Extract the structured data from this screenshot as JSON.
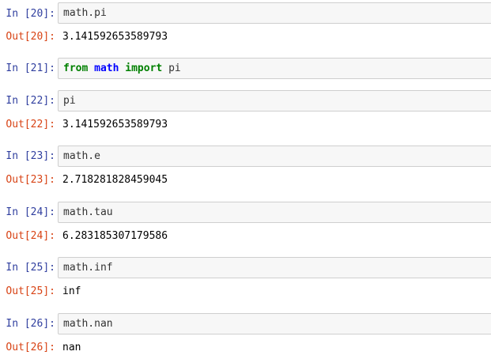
{
  "cells": [
    {
      "in_prompt": "In [20]:",
      "code": "math.pi",
      "out_prompt": "Out[20]:",
      "output": "3.141592653589793"
    },
    {
      "in_prompt": "In [21]:",
      "code_tokens": {
        "kw1": "from",
        "mod": "math",
        "kw2": "import",
        "name": "pi"
      }
    },
    {
      "in_prompt": "In [22]:",
      "code": "pi",
      "out_prompt": "Out[22]:",
      "output": "3.141592653589793"
    },
    {
      "in_prompt": "In [23]:",
      "code": "math.e",
      "out_prompt": "Out[23]:",
      "output": "2.718281828459045"
    },
    {
      "in_prompt": "In [24]:",
      "code": "math.tau",
      "out_prompt": "Out[24]:",
      "output": "6.283185307179586"
    },
    {
      "in_prompt": "In [25]:",
      "code": "math.inf",
      "out_prompt": "Out[25]:",
      "output": "inf"
    },
    {
      "in_prompt": "In [26]:",
      "code": "math.nan",
      "out_prompt": "Out[26]:",
      "output": "nan"
    }
  ],
  "colors": {
    "in_prompt": "#303f9f",
    "out_prompt": "#d84315",
    "keyword": "#008000",
    "module_name": "#0000ff",
    "input_background": "#f7f7f7",
    "input_border": "#cfcfcf"
  }
}
